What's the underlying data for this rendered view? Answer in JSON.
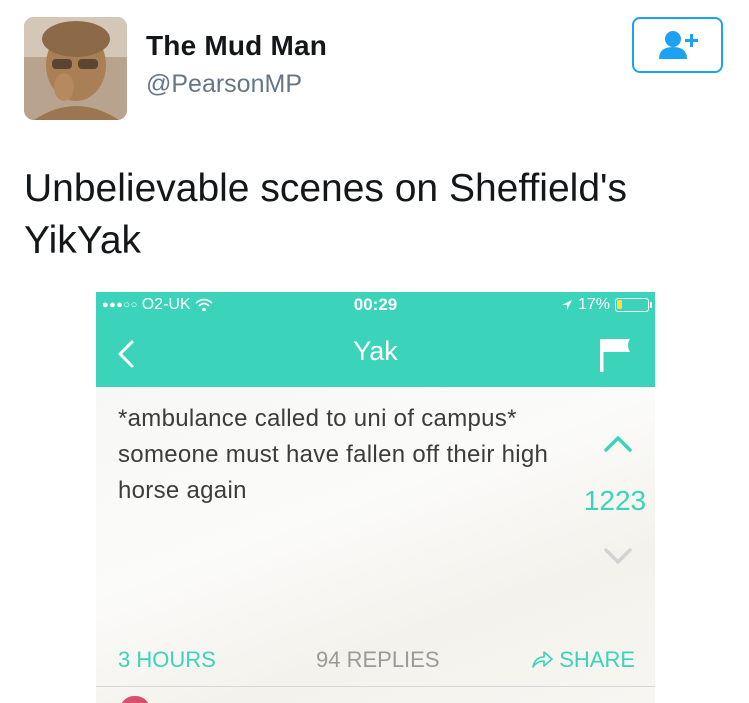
{
  "tweet": {
    "author": {
      "display_name": "The Mud Man",
      "handle": "@PearsonMP"
    },
    "follow_icon": "add-user-icon",
    "text": "Unbelievable scenes on Sheffield's YikYak",
    "accent_color": "#1da1f2"
  },
  "yak_screenshot": {
    "status_bar": {
      "carrier": "O2-UK",
      "time": "00:29",
      "battery": "17%",
      "battery_level": 0.17
    },
    "nav": {
      "title": "Yak",
      "back_icon": "chevron-left-icon",
      "flag_icon": "flag-icon"
    },
    "post": {
      "text": "*ambulance called to uni of campus* someone must have fallen off their high horse again",
      "votes": "1223",
      "time_ago": "3 HOURS",
      "replies": "94 REPLIES",
      "share_label": "SHARE"
    },
    "brand_color": "#3bd3b9"
  }
}
